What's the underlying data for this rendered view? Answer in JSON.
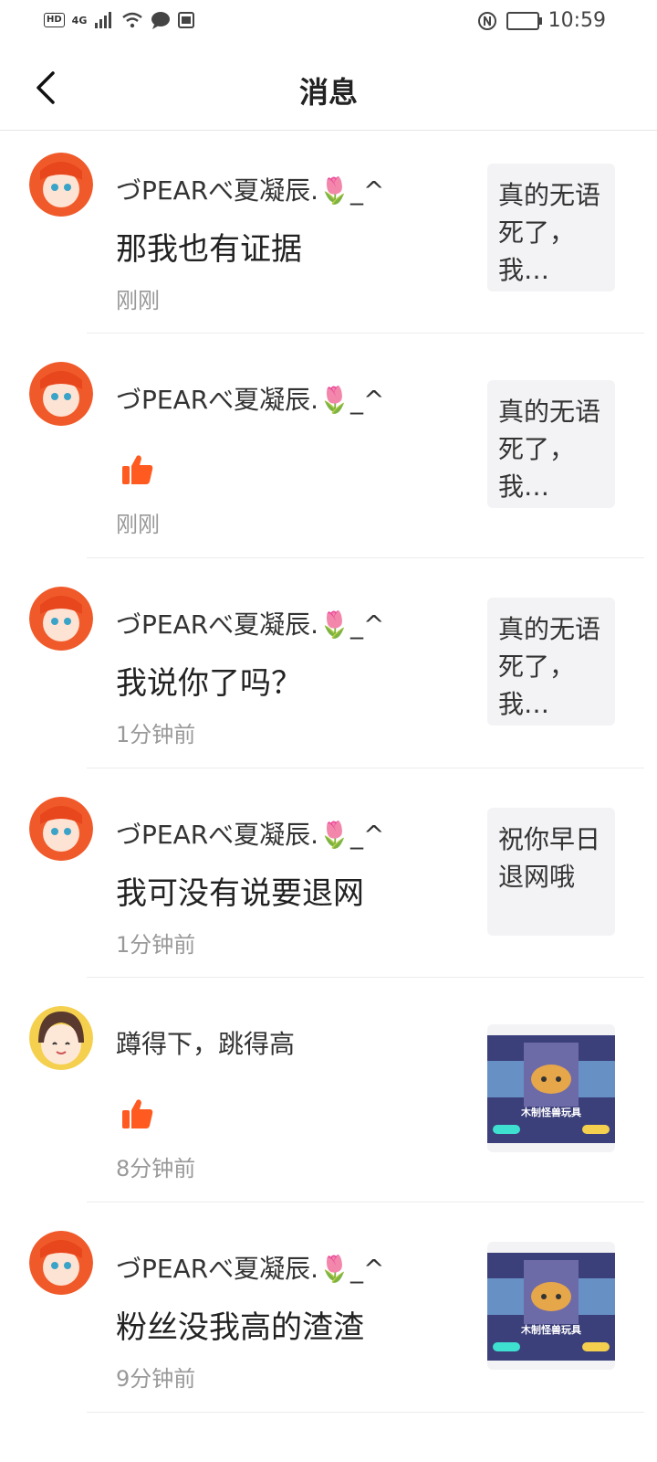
{
  "status_bar": {
    "left": [
      "HD",
      "4G"
    ],
    "time": "10:59"
  },
  "header": {
    "title": "消息"
  },
  "messages": [
    {
      "user": "づPEARべ夏凝辰.🌷_^",
      "content": "那我也有证据",
      "time": "刚刚",
      "quote": "真的无语死了，我…"
    },
    {
      "user": "づPEARべ夏凝辰.🌷_^",
      "content": "",
      "like": true,
      "time": "刚刚",
      "quote": "真的无语死了，我…"
    },
    {
      "user": "づPEARべ夏凝辰.🌷_^",
      "content": "我说你了吗？",
      "time": "1分钟前",
      "quote": "真的无语死了，我…"
    },
    {
      "user": "づPEARべ夏凝辰.🌷_^",
      "content": "我可没有说要退网",
      "time": "1分钟前",
      "quote": "祝你早日退网哦"
    },
    {
      "user": "蹲得下，跳得高",
      "content": "",
      "like": true,
      "time": "8分钟前",
      "thumb_text": "木制怪兽玩具"
    },
    {
      "user": "づPEARべ夏凝辰.🌷_^",
      "content": "粉丝没我高的渣渣",
      "time": "9分钟前",
      "thumb_text": "木制怪兽玩具"
    }
  ],
  "colors": {
    "accent": "#ff5a1f",
    "text": "#222222",
    "muted": "#999999",
    "quote_bg": "#f3f3f5"
  },
  "icons": {
    "back": "chevron-left-icon",
    "like": "thumbs-up-icon"
  }
}
